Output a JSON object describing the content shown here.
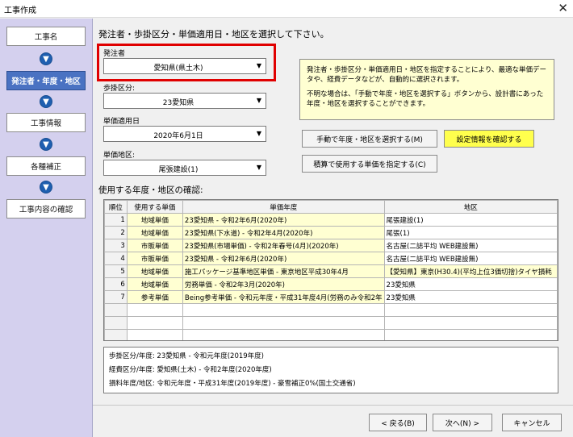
{
  "window": {
    "title": "工事作成",
    "close_glyph": "✕"
  },
  "sidebar": {
    "steps": [
      {
        "label": "工事名"
      },
      {
        "label": "発注者・年度・地区"
      },
      {
        "label": "工事情報"
      },
      {
        "label": "各種補正"
      },
      {
        "label": "工事内容の確認"
      }
    ]
  },
  "instruction": "発注者・歩掛区分・単価適用日・地区を選択して下さい。",
  "fields": {
    "orderer": {
      "label": "発注者",
      "value": "愛知県(県土木)"
    },
    "category": {
      "label": "歩掛区分:",
      "value": "23愛知県"
    },
    "date": {
      "label": "単価適用日",
      "value": "2020年6月1日"
    },
    "region": {
      "label": "単価地区:",
      "value": "尾張建設(1)"
    }
  },
  "info": {
    "p1": "発注者・歩掛区分・単価適用日・地区を指定することにより、最適な単価データや、経費データなどが、自動的に選択されます。",
    "p2": "不明な場合は、「手動で年度・地区を選択する」ボタンから、設計書にあった年度・地区を選択することができます。"
  },
  "buttons": {
    "manual": "手動で年度・地区を選択する(M)",
    "confirm_settings": "設定情報を確認する",
    "estimate": "積算で使用する単価を指定する(C)",
    "back": "< 戻る(B)",
    "next": "次へ(N) >",
    "cancel": "キャンセル"
  },
  "table_title": "使用する年度・地区の確認:",
  "table": {
    "headers": [
      "順位",
      "使用する単価",
      "単価年度",
      "地区"
    ],
    "rows": [
      [
        "1",
        "地域単価",
        "23愛知県 - 令和2年6月(2020年)",
        "尾張建設(1)"
      ],
      [
        "2",
        "地域単価",
        "23愛知県(下水道) - 令和2年4月(2020年)",
        "尾張(1)"
      ],
      [
        "3",
        "市販単価",
        "23愛知県(市場単価) - 令和2年春号(4月)(2020年)",
        "名古屋(二誌平均 WEB建設無)"
      ],
      [
        "4",
        "市販単価",
        "23愛知県 - 令和2年6月(2020年)",
        "名古屋(二誌平均 WEB建設無)"
      ],
      [
        "5",
        "地域単価",
        "施工パッケージ基準地区単価 - 東京地区平成30年4月",
        "【愛知県】東京(H30.4)(平均上位3価切捨)タイヤ損耗"
      ],
      [
        "6",
        "地域単価",
        "労務単価 - 令和2年3月(2020年)",
        "23愛知県"
      ],
      [
        "7",
        "参考単価",
        "Being参考単価 - 令和元年度・平成31年度4月(労務のみ令和2年",
        "23愛知県"
      ]
    ]
  },
  "summary": {
    "line1": "歩掛区分/年度: 23愛知県 - 令和元年度(2019年度)",
    "line2": "経費区分/年度: 愛知県(土木) - 令和2年度(2020年度)",
    "line3": "損料年度/地区: 令和元年度・平成31年度(2019年度) - 豪雪補正0%(国土交通省)"
  },
  "colors": {
    "highlight": "#e00000",
    "active_step": "#4a72c2",
    "info_bg": "#ffffd2",
    "confirm_button": "#ffff4d"
  }
}
